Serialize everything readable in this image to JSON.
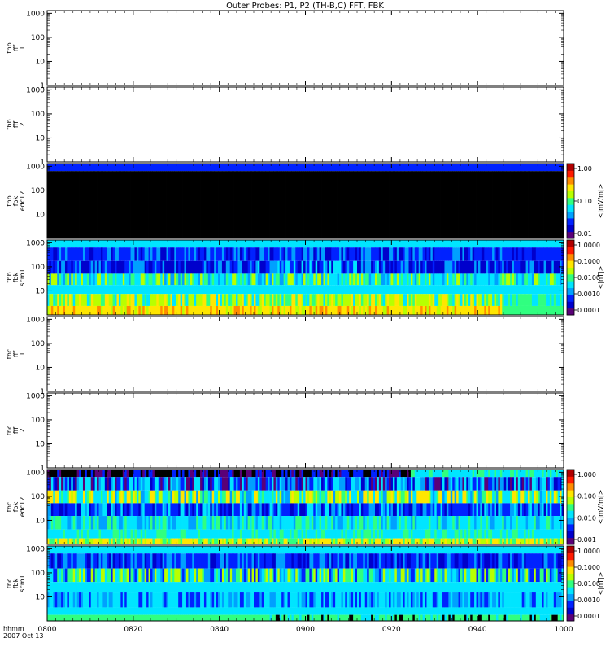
{
  "title": "Outer Probes: P1, P2 (TH-B,C) FFT, FBK",
  "chart_data": [
    {
      "type": "heatmap",
      "ylabel": [
        "thb",
        "fff",
        "1"
      ],
      "yticks": [
        "1",
        "10",
        "100",
        "1000"
      ],
      "ylog": true,
      "ylim": [
        1,
        1000
      ],
      "empty": true
    },
    {
      "type": "heatmap",
      "ylabel": [
        "thb",
        "fff",
        "2"
      ],
      "yticks": [
        "1",
        "10",
        "100",
        "1000"
      ],
      "ylog": true,
      "ylim": [
        1,
        1000
      ],
      "empty": true
    },
    {
      "type": "heatmap",
      "ylabel": [
        "thb",
        "fbk",
        "edc12"
      ],
      "yticks": [
        "10",
        "100",
        "1000"
      ],
      "ylog": true,
      "colorbar": {
        "label": "<|mV/m|>",
        "ticks": [
          "1.00",
          "0.10",
          "0.01"
        ]
      },
      "scheme": "edc_thb"
    },
    {
      "type": "heatmap",
      "ylabel": [
        "thb",
        "fbk",
        "scm1"
      ],
      "yticks": [
        "10",
        "100",
        "1000"
      ],
      "ylog": true,
      "colorbar": {
        "label": "<|nT|>",
        "ticks": [
          "1.0000",
          "0.1000",
          "0.0100",
          "0.0010",
          "0.0001"
        ]
      },
      "scheme": "scm_thb"
    },
    {
      "type": "heatmap",
      "ylabel": [
        "thc",
        "fff",
        "1"
      ],
      "yticks": [
        "1",
        "10",
        "100",
        "1000"
      ],
      "ylog": true,
      "ylim": [
        1,
        1000
      ],
      "empty": true
    },
    {
      "type": "heatmap",
      "ylabel": [
        "thc",
        "fff",
        "2"
      ],
      "yticks": [
        "1",
        "10",
        "100",
        "1000"
      ],
      "ylog": true,
      "ylim": [
        1,
        1000
      ],
      "empty": true
    },
    {
      "type": "heatmap",
      "ylabel": [
        "thc",
        "fbk",
        "edc12"
      ],
      "yticks": [
        "10",
        "100",
        "1000"
      ],
      "ylog": true,
      "colorbar": {
        "label": "<|mV/m|>",
        "ticks": [
          "1.000",
          "0.100",
          "0.010",
          "0.001"
        ]
      },
      "scheme": "edc_thc"
    },
    {
      "type": "heatmap",
      "ylabel": [
        "thc",
        "fbk",
        "scm1"
      ],
      "yticks": [
        "10",
        "100",
        "1000"
      ],
      "ylog": true,
      "colorbar": {
        "label": "<|nT|>",
        "ticks": [
          "1.0000",
          "0.1000",
          "0.0100",
          "0.0010",
          "0.0001"
        ]
      },
      "scheme": "scm_thc"
    }
  ],
  "xaxis": {
    "ticks": [
      "0800",
      "0820",
      "0840",
      "0900",
      "0920",
      "0940",
      "1000"
    ],
    "label_line1": "hhmm",
    "label_line2": "2007 Oct 13"
  },
  "colors": {
    "jet": [
      "#5a0078",
      "#0000cc",
      "#0022ff",
      "#00a0ff",
      "#00e5ff",
      "#30ff80",
      "#b8ff00",
      "#ffe600",
      "#ff8c00",
      "#ff1a00",
      "#b00000"
    ]
  }
}
